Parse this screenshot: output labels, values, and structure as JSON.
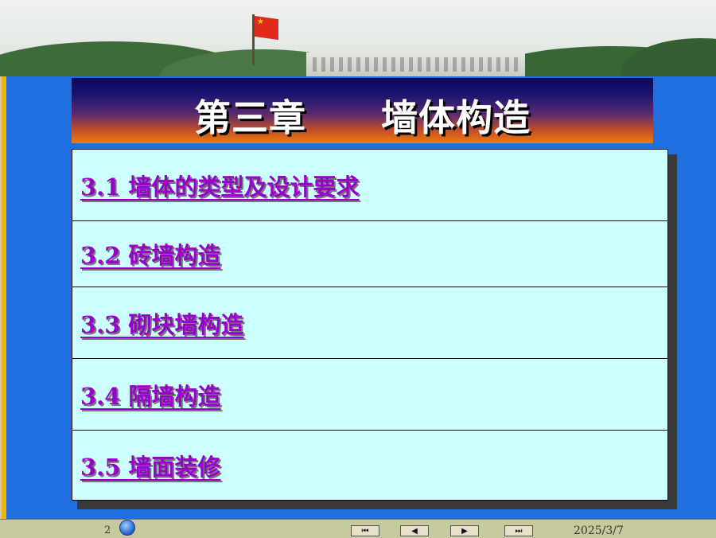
{
  "title": "第三章　　墙体构造",
  "menu": {
    "items": [
      {
        "label": "3.1  墙体的类型及设计要求"
      },
      {
        "label": "3.2  砖墙构造"
      },
      {
        "label": "3.3  砌块墙构造"
      },
      {
        "label": "3.4  隔墙构造"
      },
      {
        "label": "3.5  墙面装修"
      }
    ]
  },
  "footer": {
    "page_number": "2",
    "date": "2025/3/7",
    "nav": [
      {
        "icon": "first-slide-icon",
        "glyph": "⏮"
      },
      {
        "icon": "previous-slide-icon",
        "glyph": "◀"
      },
      {
        "icon": "next-slide-icon",
        "glyph": "▶"
      },
      {
        "icon": "last-slide-icon",
        "glyph": "⏭"
      }
    ]
  },
  "colors": {
    "background": "#1f6fe0",
    "menu_background": "#ccffff",
    "link": "#9900cc",
    "title_text": "#ffffff"
  }
}
